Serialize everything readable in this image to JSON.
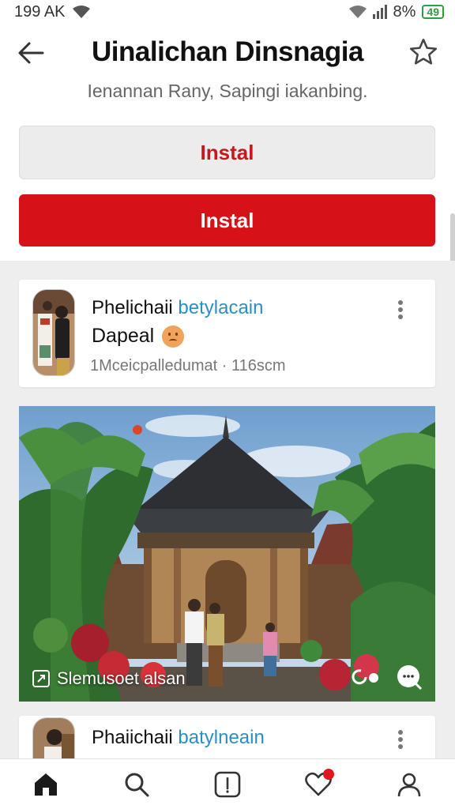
{
  "status_bar": {
    "time": "199 AK",
    "battery_prefix": "8%",
    "battery": "49"
  },
  "header": {
    "title": "Uinalichan Dinsnagia",
    "subtitle": "Ienannan Rany, Sapingi iakanbing."
  },
  "buttons": {
    "install_light": "Instal",
    "install_red": "Instal"
  },
  "post1": {
    "name": "Phelichaii",
    "handle": "betylacain",
    "text": "Dapeal",
    "meta": "1Mceicpalledumat · 116scm"
  },
  "photo": {
    "caption": "Slemusoet alsan"
  },
  "post2": {
    "name": "Phaiichaii",
    "handle": "batylneain"
  },
  "icons": {
    "back": "back-arrow-icon",
    "star": "star-icon",
    "home": "home-icon",
    "search": "search-icon",
    "info": "info-icon",
    "likes": "heart-icon",
    "profile": "profile-icon"
  },
  "colors": {
    "accent": "#d61117",
    "link": "#2b8fc4"
  }
}
